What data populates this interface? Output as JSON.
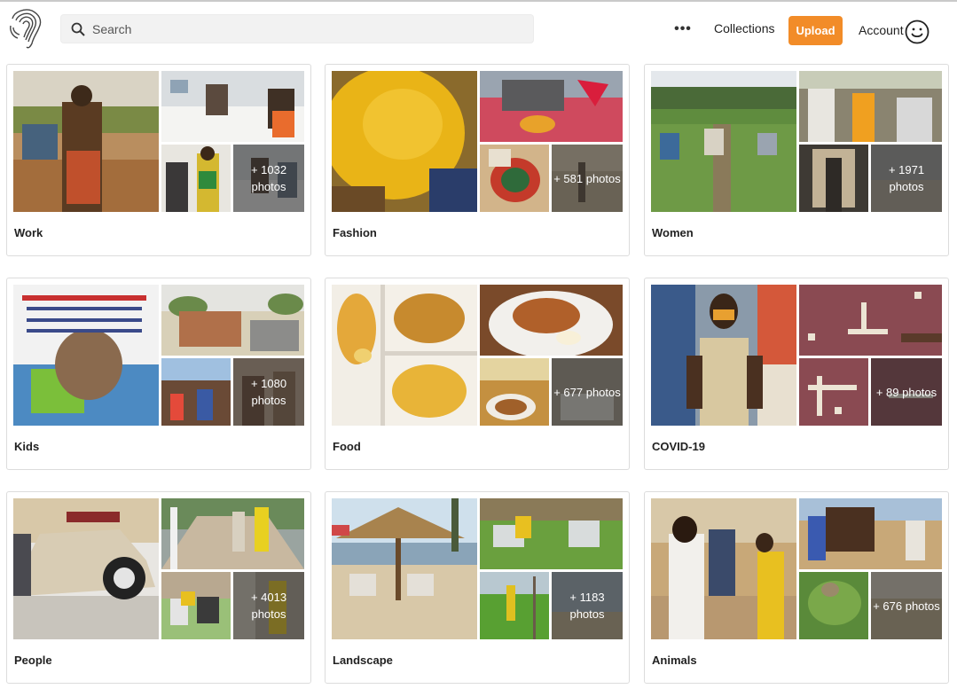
{
  "header": {
    "search_placeholder": "Search",
    "more_label": "•••",
    "collections_label": "Collections",
    "upload_label": "Upload",
    "account_label": "Account",
    "accent_color": "#f28c28"
  },
  "cards": [
    {
      "name": "Work",
      "count_text": "+ 1032 photos"
    },
    {
      "name": "Fashion",
      "count_text": "+ 581 photos"
    },
    {
      "name": "Women",
      "count_text": "+ 1971 photos"
    },
    {
      "name": "Kids",
      "count_text": "+ 1080 photos"
    },
    {
      "name": "Food",
      "count_text": "+ 677 photos"
    },
    {
      "name": "COVID-19",
      "count_text": "+ 89 photos"
    },
    {
      "name": "People",
      "count_text": "+ 4013 photos"
    },
    {
      "name": "Landscape",
      "count_text": "+ 1183 photos"
    },
    {
      "name": "Animals",
      "count_text": "+ 676 photos"
    }
  ]
}
